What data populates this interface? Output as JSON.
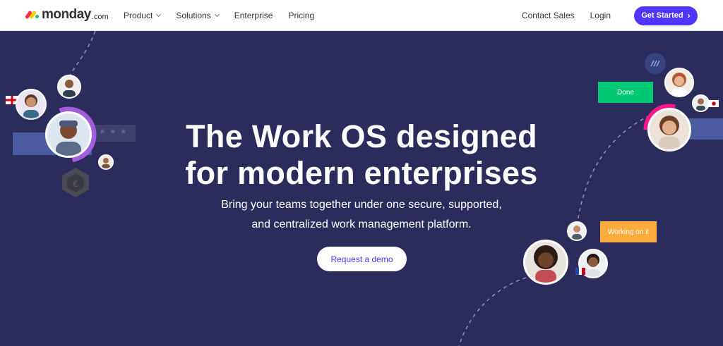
{
  "nav": {
    "logo_word": "monday",
    "logo_suffix": ".com",
    "items": [
      {
        "label": "Product",
        "has_dropdown": true
      },
      {
        "label": "Solutions",
        "has_dropdown": true
      },
      {
        "label": "Enterprise",
        "has_dropdown": false
      },
      {
        "label": "Pricing",
        "has_dropdown": false
      }
    ],
    "contact_sales": "Contact Sales",
    "login": "Login",
    "get_started": "Get Started"
  },
  "hero": {
    "headline_line1": "The Work OS designed",
    "headline_line2": "for modern enterprises",
    "sub_line1": "Bring your teams together under one secure, supported,",
    "sub_line2": "and centralized work management platform.",
    "cta": "Request a demo",
    "status_done": "Done",
    "status_working": "Working on it"
  },
  "colors": {
    "hero_bg": "#2b2c5c",
    "brand_blue": "#5034ff",
    "done_green": "#00c875",
    "working_orange": "#fdab3d",
    "accent_purple": "#a25ddc",
    "accent_pink": "#ff158a"
  },
  "icons": {
    "chevron": "chevron-down-icon",
    "arrow": "chevron-right-icon"
  }
}
